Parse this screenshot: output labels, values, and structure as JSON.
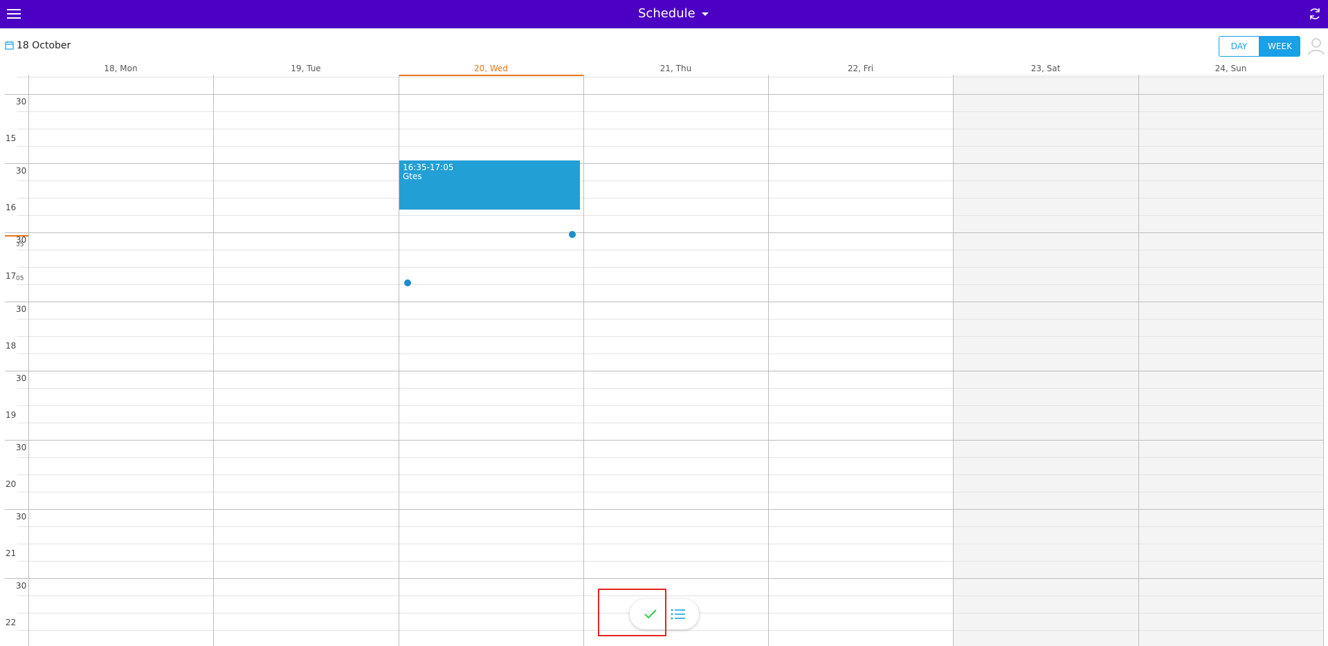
{
  "app": {
    "title": "Schedule",
    "menu_icon": "hamburger-menu-icon",
    "sync_icon": "sync-icon",
    "bar_color": "#4b00c4"
  },
  "toolbar": {
    "current_date": "18 October",
    "date_icon": "calendar-icon",
    "views": {
      "day": "DAY",
      "week": "WEEK",
      "active": "WEEK"
    },
    "user_icon": "user-icon",
    "accent_color": "#1aa0e6"
  },
  "week": {
    "days": [
      "18, Mon",
      "19, Tue",
      "20, Wed",
      "21, Thu",
      "22, Fri",
      "23, Sat",
      "24, Sun"
    ],
    "today": "20, Wed",
    "weekend": [
      "23, Sat",
      "24, Sun"
    ],
    "today_color": "#e8751a"
  },
  "time_axis": {
    "labels": [
      "30",
      "15",
      "30",
      "16",
      "30",
      "17",
      "30",
      "18",
      "30",
      "19",
      "30",
      "20",
      "30",
      "21",
      "30",
      "22"
    ],
    "drag_indicator_start": "35",
    "drag_indicator_end": "05"
  },
  "events": [
    {
      "day": "20, Wed",
      "time": "16:35-17:05",
      "title": "Gtes",
      "color": "#229fd5"
    }
  ],
  "actions": {
    "confirm_icon": "check-icon",
    "list_icon": "list-icon"
  }
}
